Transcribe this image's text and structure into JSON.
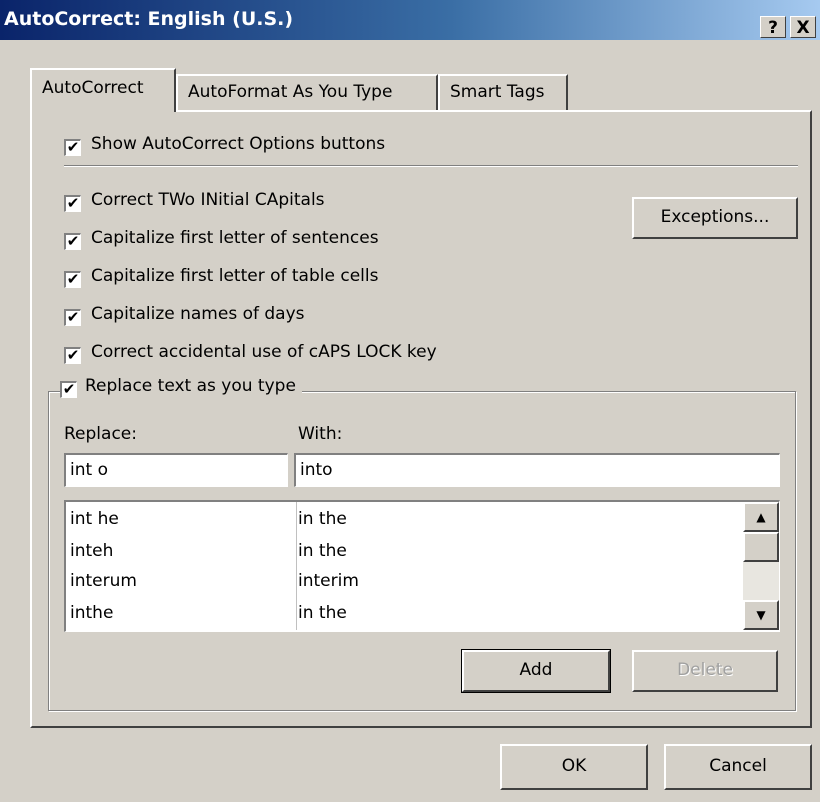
{
  "window": {
    "title": "AutoCorrect: English (U.S.)",
    "help_button": "?",
    "close_button": "X"
  },
  "tabs": [
    {
      "label": "AutoCorrect",
      "active": true
    },
    {
      "label": "AutoFormat As You Type",
      "active": false
    },
    {
      "label": "Smart Tags",
      "active": false
    }
  ],
  "options": {
    "show_buttons": {
      "label": "Show AutoCorrect Options buttons",
      "checked": true
    },
    "two_initial_caps": {
      "label": "Correct TWo INitial CApitals",
      "checked": true
    },
    "cap_sentences": {
      "label": "Capitalize first letter of sentences",
      "checked": true
    },
    "cap_table_cells": {
      "label": "Capitalize first letter of table cells",
      "checked": true
    },
    "cap_days": {
      "label": "Capitalize names of days",
      "checked": true
    },
    "caps_lock": {
      "label": "Correct accidental use of cAPS LOCK key",
      "checked": true
    },
    "replace_text": {
      "label": "Replace text as you type",
      "checked": true
    }
  },
  "check_mark": "✔",
  "exceptions_label": "Exceptions...",
  "replace": {
    "replace_label": "Replace:",
    "with_label": "With:",
    "replace_value": "int o",
    "with_value": "into",
    "rows": [
      {
        "from": "int he",
        "to": "in the"
      },
      {
        "from": "inteh",
        "to": "in the"
      },
      {
        "from": "interum",
        "to": "interim"
      },
      {
        "from": "inthe",
        "to": "in the"
      }
    ],
    "scroll_up": "▲",
    "scroll_down": "▼",
    "add_label": "Add",
    "delete_label": "Delete"
  },
  "footer": {
    "ok_label": "OK",
    "cancel_label": "Cancel"
  }
}
